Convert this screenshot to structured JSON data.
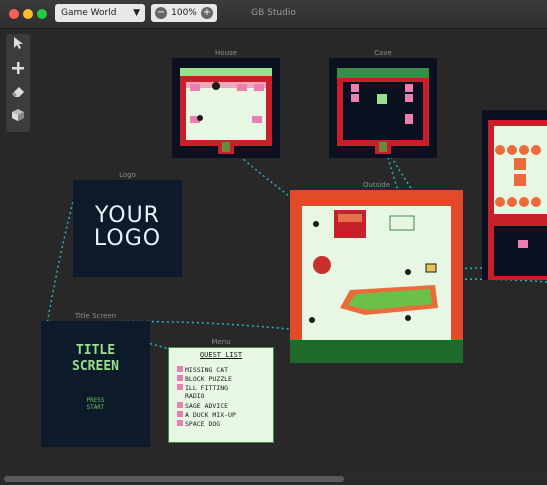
{
  "window": {
    "title": "GB Studio"
  },
  "toolbar": {
    "world_select": "Game World",
    "zoom_out": "−",
    "zoom_level": "100%",
    "zoom_in": "+"
  },
  "scenes": {
    "house": "House",
    "cave": "Cave",
    "logo": "Logo",
    "outside": "Outside",
    "title_screen": "Title Screen",
    "menu": "Menu"
  },
  "logo_art": {
    "line1": "YOUR",
    "line2": "LOGO"
  },
  "title_art": {
    "line1": "TITLE",
    "line2": "SCREEN",
    "press": "PRESS",
    "start": "START"
  },
  "quest_list": {
    "header": "QUEST LIST",
    "items": [
      "MISSING CAT",
      "BLOCK PUZZLE",
      "ILL FITTING",
      "RADIO",
      "SAGE ADVICE",
      "A DUCK MIX-UP",
      "SPACE DOG"
    ]
  },
  "icons": {
    "select": "cursor-icon",
    "add": "plus-icon",
    "eraser": "eraser-icon",
    "colors": "cube-icon"
  }
}
